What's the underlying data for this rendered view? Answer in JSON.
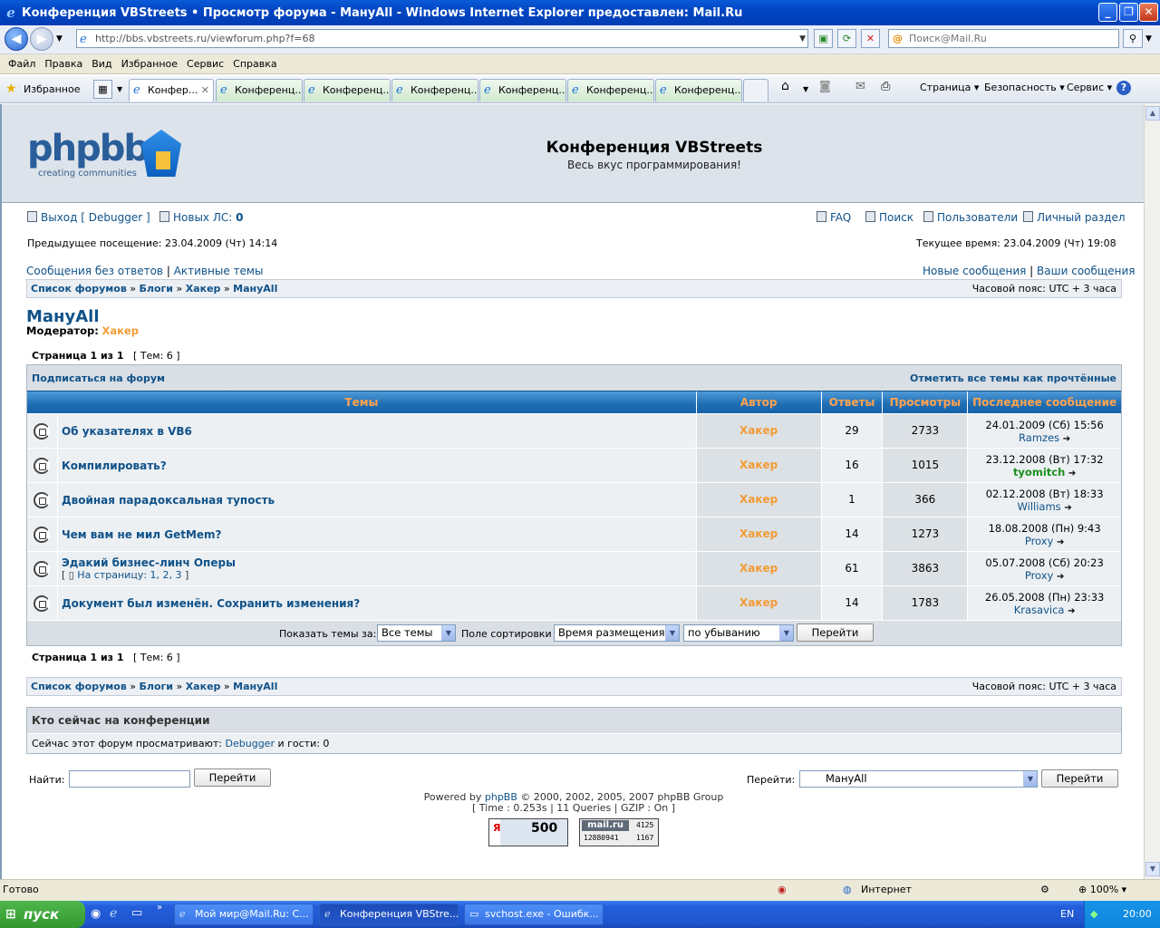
{
  "window": {
    "title": "Конференция VBStreets • Просмотр форума - МануAll - Windows Internet Explorer предоставлен: Mail.Ru"
  },
  "browser": {
    "address": "http://bbs.vbstreets.ru/viewforum.php?f=68",
    "search_placeholder": "Поиск@Mail.Ru",
    "menu": [
      "Файл",
      "Правка",
      "Вид",
      "Избранное",
      "Сервис",
      "Справка"
    ],
    "favorites_label": "Избранное",
    "tabs": [
      "Конфер...",
      "Конференц...",
      "Конференц...",
      "Конференц...",
      "Конференц...",
      "Конференц...",
      "Конференц..."
    ],
    "cmd": {
      "page": "Страница",
      "security": "Безопасность",
      "tools": "Сервис"
    }
  },
  "site": {
    "name": "Конференция VBStreets",
    "desc": "Весь вкус программирования!",
    "logo_text": "phpbb",
    "logo_sub": "creating communities"
  },
  "user": {
    "logout": "Выход [ Debugger ]",
    "pm_label": "Новых ЛС:",
    "pm_count": "0"
  },
  "links": {
    "faq": "FAQ",
    "search": "Поиск",
    "members": "Пользователи",
    "profile": "Личный раздел",
    "last_visit": "Предыдущее посещение: 23.04.2009 (Чт) 14:14",
    "current_time": "Текущее время: 23.04.2009 (Чт) 19:08",
    "unanswered": "Сообщения без ответов",
    "active": "Активные темы",
    "new_posts": "Новые сообщения",
    "your_posts": "Ваши сообщения"
  },
  "breadcrumb": {
    "items": [
      "Список форумов",
      "Блоги",
      "Хакер",
      "МануAll"
    ],
    "tz": "Часовой пояс: UTC + 3 часа"
  },
  "forum": {
    "title": "МануAll",
    "mod_label": "Модератор:",
    "mod_name": "Хакер",
    "page_label": "Страница 1 из 1",
    "topics_label": "[ Тем: 6 ]",
    "subscribe": "Подписаться на форум",
    "mark_read": "Отметить все темы как прочтённые"
  },
  "table": {
    "headers": [
      "Темы",
      "Автор",
      "Ответы",
      "Просмотры",
      "Последнее сообщение"
    ],
    "rows": [
      {
        "title": "Об указателях в VB6",
        "pages": "",
        "author": "Хакер",
        "replies": "29",
        "views": "2733",
        "last_date": "24.01.2009 (Сб) 15:56",
        "last_user": "Ramzes",
        "last_color": "#105289"
      },
      {
        "title": "Компилировать?",
        "pages": "",
        "author": "Хакер",
        "replies": "16",
        "views": "1015",
        "last_date": "23.12.2008 (Вт) 17:32",
        "last_user": "tyomitch",
        "last_color": "#1b8f1b"
      },
      {
        "title": "Двойная парадоксальная тупость",
        "pages": "",
        "author": "Хакер",
        "replies": "1",
        "views": "366",
        "last_date": "02.12.2008 (Вт) 18:33",
        "last_user": "Williams",
        "last_color": "#105289"
      },
      {
        "title": "Чем вам не мил GetMem?",
        "pages": "",
        "author": "Хакер",
        "replies": "14",
        "views": "1273",
        "last_date": "18.08.2008 (Пн) 9:43",
        "last_user": "Proxy",
        "last_color": "#105289"
      },
      {
        "title": "Эдакий бизнес-линч Оперы",
        "pages": "На страницу: 1, 2, 3",
        "author": "Хакер",
        "replies": "61",
        "views": "3863",
        "last_date": "05.07.2008 (Сб) 20:23",
        "last_user": "Proxy",
        "last_color": "#105289"
      },
      {
        "title": "Документ был изменён. Сохранить изменения?",
        "pages": "",
        "author": "Хакер",
        "replies": "14",
        "views": "1783",
        "last_date": "26.05.2008 (Пн) 23:33",
        "last_user": "Krasavica",
        "last_color": "#105289"
      }
    ],
    "footer": {
      "show_label": "Показать темы за:",
      "show_value": "Все темы",
      "sort_label": "Поле сортировки",
      "sort_value": "Время размещения",
      "order_value": "по убыванию",
      "go": "Перейти"
    }
  },
  "online": {
    "title": "Кто сейчас на конференции",
    "text_prefix": "Сейчас этот форум просматривают:",
    "user": "Debugger",
    "text_suffix": "и гости: 0"
  },
  "bottom": {
    "find_label": "Найти:",
    "go": "Перейти",
    "jump_label": "Перейти:",
    "jump_value": "МануAll",
    "powered": "Powered by",
    "phpbb": "phpBB",
    "copyright": "© 2000, 2002, 2005, 2007 phpBB Group",
    "stats": "[ Time : 0.253s | 11 Queries | GZIP : On ]",
    "counter1": "500",
    "counter2_a": "4125",
    "counter2_b": "12880941",
    "counter2_c": "1167"
  },
  "status": {
    "text": "Готово",
    "zone": "Интернет",
    "zoom": "100%"
  },
  "taskbar": {
    "start": "пуск",
    "tasks": [
      "Мой мир@Mail.Ru: С...",
      "Конференция VBStre...",
      "svchost.exe - Ошибк..."
    ],
    "lang": "EN",
    "clock": "20:00"
  }
}
